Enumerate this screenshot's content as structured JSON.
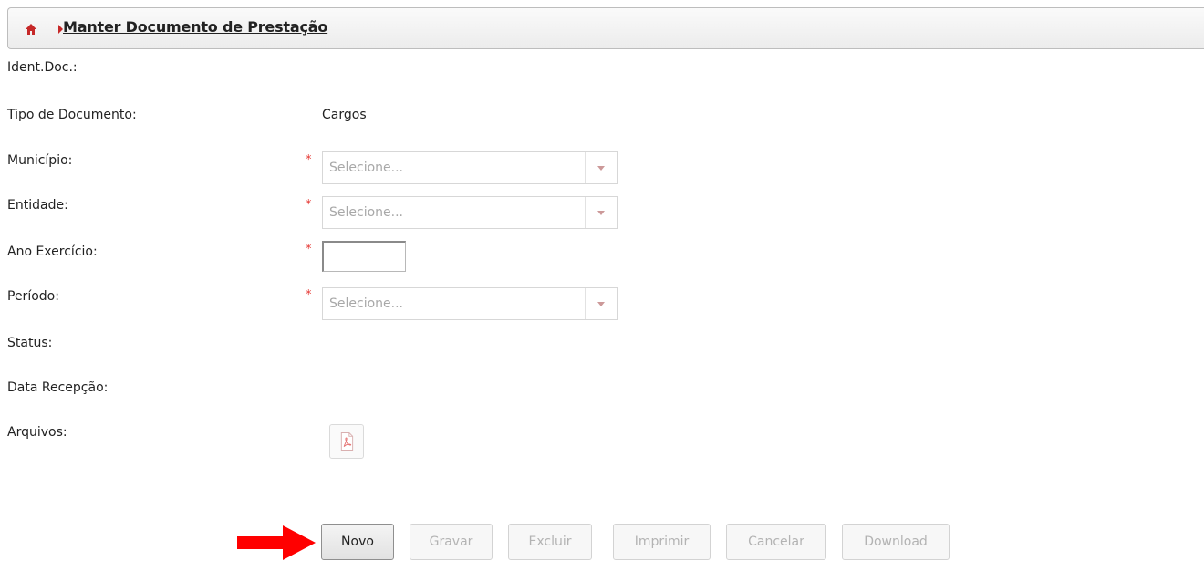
{
  "header": {
    "title": "Manter Documento de Prestação"
  },
  "form": {
    "ident_doc_label": "Ident.Doc.:",
    "tipo_documento_label": "Tipo de Documento:",
    "tipo_documento_value": "Cargos",
    "municipio_label": "Município:",
    "municipio_placeholder": "Selecione...",
    "entidade_label": "Entidade:",
    "entidade_placeholder": "Selecione...",
    "ano_exercicio_label": "Ano Exercício:",
    "ano_exercicio_value": "",
    "periodo_label": "Período:",
    "periodo_placeholder": "Selecione...",
    "status_label": "Status:",
    "data_recepcao_label": "Data Recepção:",
    "arquivos_label": "Arquivos:",
    "required_mark": "*"
  },
  "buttons": {
    "novo": "Novo",
    "gravar": "Gravar",
    "excluir": "Excluir",
    "imprimir": "Imprimir",
    "cancelar": "Cancelar",
    "download": "Download"
  },
  "colors": {
    "required": "#e53935",
    "annotation_arrow": "#ff0000",
    "home_icon": "#c62828"
  },
  "icons": {
    "home": "home-icon",
    "breadcrumb_separator": "chevron-right-icon",
    "dropdown": "chevron-down-icon",
    "file": "pdf-icon",
    "annotation": "red-arrow-icon"
  }
}
